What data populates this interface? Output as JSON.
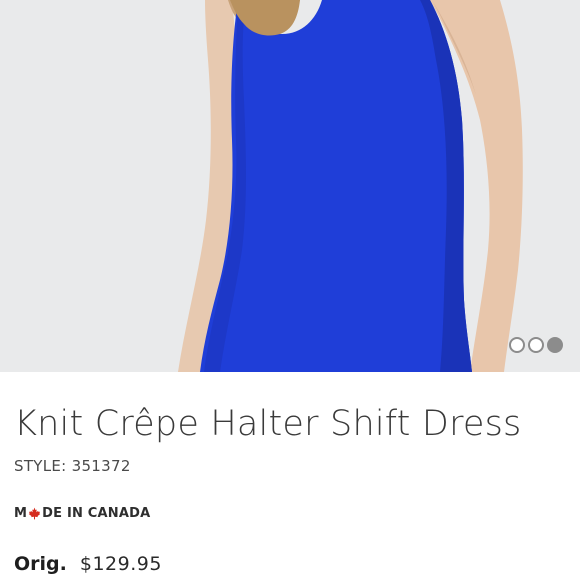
{
  "product": {
    "title": "Knit Crêpe Halter Shift Dress",
    "style_label": "STYLE:",
    "style_number": "351372",
    "made_in_prefix": "M",
    "made_in_suffix": "DE IN CANADA",
    "orig_label": "Orig.",
    "orig_price": "$129.95"
  },
  "gallery": {
    "slide_count": 3,
    "active_slide": 3,
    "dress_color": "#1f3ed8",
    "background_color": "#e9eaeb"
  },
  "colors": {
    "maple_leaf": "#d52b1e",
    "dot_gray": "#8c8c8c"
  }
}
